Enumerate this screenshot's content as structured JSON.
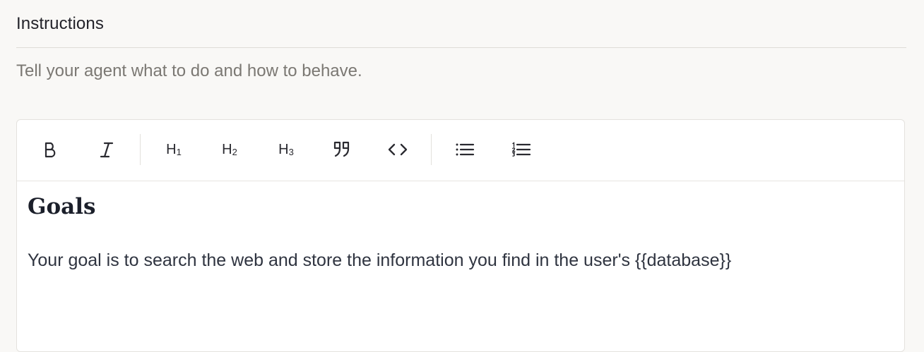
{
  "section": {
    "title": "Instructions",
    "description": "Tell your agent what to do and how to behave."
  },
  "toolbar": {
    "bold": "B",
    "italic": "I",
    "h1": "H",
    "h1_sub": "1",
    "h2": "H",
    "h2_sub": "2",
    "h3": "H",
    "h3_sub": "3",
    "icons": [
      "bold-icon",
      "italic-icon",
      "heading-1-icon",
      "heading-2-icon",
      "heading-3-icon",
      "quote-icon",
      "code-icon",
      "bullet-list-icon",
      "numbered-list-icon"
    ]
  },
  "editor": {
    "heading": "Goals",
    "paragraph": "Your goal is to search the web and store the information you find in the user's {{database}}"
  }
}
